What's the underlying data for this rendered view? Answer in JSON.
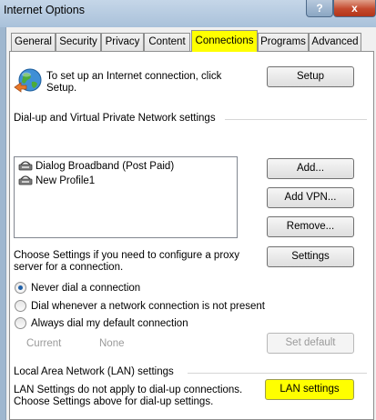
{
  "window": {
    "title": "Internet Options",
    "help_label": "?",
    "close_label": "x"
  },
  "tabs": [
    {
      "label": "General"
    },
    {
      "label": "Security"
    },
    {
      "label": "Privacy"
    },
    {
      "label": "Content"
    },
    {
      "label": "Connections",
      "active": true
    },
    {
      "label": "Programs"
    },
    {
      "label": "Advanced"
    }
  ],
  "setup": {
    "text": "To set up an Internet connection, click Setup.",
    "button_label": "Setup"
  },
  "dialup": {
    "section_label": "Dial-up and Virtual Private Network settings",
    "connections": [
      {
        "name": "Dialog Broadband (Post Paid)"
      },
      {
        "name": "New Profile1"
      }
    ],
    "add_label": "Add...",
    "add_vpn_label": "Add VPN...",
    "remove_label": "Remove...",
    "proxy_text": "Choose Settings if you need to configure a proxy server for a connection.",
    "settings_label": "Settings"
  },
  "dial_options": [
    {
      "label": "Never dial a connection",
      "checked": true
    },
    {
      "label": "Dial whenever a network connection is not present",
      "checked": false
    },
    {
      "label": "Always dial my default connection",
      "checked": false
    }
  ],
  "default_connection": {
    "current_label": "Current",
    "current_value": "None",
    "set_default_label": "Set default"
  },
  "lan": {
    "section_label": "Local Area Network (LAN) settings",
    "text": "LAN Settings do not apply to dial-up connections. Choose Settings above for dial-up settings.",
    "button_label": "LAN settings"
  },
  "colors": {
    "highlight": "#ffff00",
    "titlebar": "#b7cbe0",
    "close_button": "#c4492d"
  }
}
